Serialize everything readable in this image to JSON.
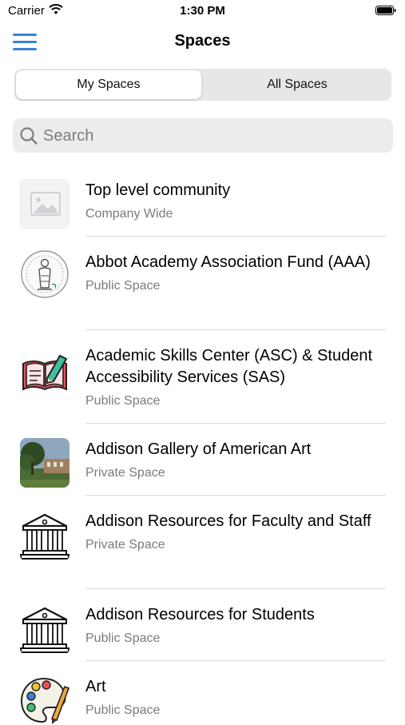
{
  "status": {
    "carrier": "Carrier",
    "time": "1:30 PM"
  },
  "nav": {
    "title": "Spaces"
  },
  "segments": [
    {
      "label": "My Spaces",
      "selected": true
    },
    {
      "label": "All Spaces",
      "selected": false
    }
  ],
  "search": {
    "placeholder": "Search"
  },
  "spaces": [
    {
      "name": "Top level community",
      "type": "Company Wide",
      "icon": "image-placeholder-icon"
    },
    {
      "name": "Abbot Academy Association Fund (AAA)",
      "type": "Public Space",
      "icon": "seal-logo-icon"
    },
    {
      "name": "Academic Skills Center (ASC) & Student Accessibility Services (SAS)",
      "type": "Public Space",
      "icon": "book-pencil-icon"
    },
    {
      "name": "Addison Gallery of American Art",
      "type": "Private Space",
      "icon": "building-photo-icon"
    },
    {
      "name": "Addison Resources for Faculty and Staff",
      "type": "Private Space",
      "icon": "museum-building-icon"
    },
    {
      "name": "Addison Resources for Students",
      "type": "Public Space",
      "icon": "museum-building-icon"
    },
    {
      "name": "Art",
      "type": "Public Space",
      "icon": "paint-palette-icon"
    }
  ],
  "colors": {
    "accent": "#3b82d6",
    "secondary_text": "#7b7b80"
  }
}
